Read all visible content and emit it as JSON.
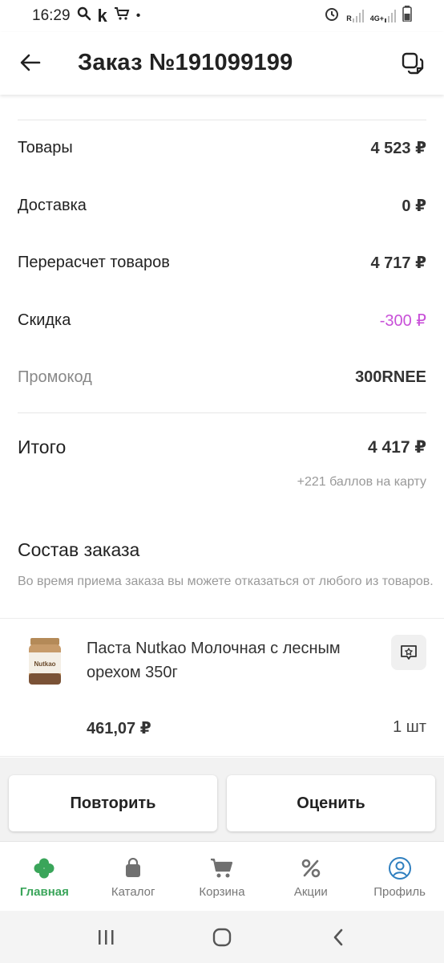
{
  "status_bar": {
    "time": "16:29",
    "k_letter": "k",
    "dot": "•",
    "network": "4G+",
    "roaming": "R"
  },
  "header": {
    "title": "Заказ №191099199"
  },
  "summary": {
    "goods_label": "Товары",
    "goods_value": "4 523 ₽",
    "delivery_label": "Доставка",
    "delivery_value": "0 ₽",
    "recalc_label": "Перерасчет товаров",
    "recalc_value": "4 717 ₽",
    "discount_label": "Скидка",
    "discount_value": "-300 ₽",
    "promo_label": "Промокод",
    "promo_value": "300RNEE",
    "total_label": "Итого",
    "total_value": "4 417 ₽",
    "bonus_text": "+221 баллов на карту"
  },
  "order": {
    "section_title": "Состав заказа",
    "note": "Во время приема заказа вы можете отказаться от любого из товаров.",
    "items": [
      {
        "name": "Паста Nutkao Молочная с лесным орехом 350г",
        "price": "461,07 ₽",
        "quantity": "1 шт",
        "jar_label": "Nutkao"
      }
    ]
  },
  "actions": {
    "repeat_label": "Повторить",
    "rate_label": "Оценить"
  },
  "bottom_nav": {
    "items": [
      {
        "label": "Главная",
        "icon": "clover-icon",
        "active": true
      },
      {
        "label": "Каталог",
        "icon": "bag-icon"
      },
      {
        "label": "Корзина",
        "icon": "cart-icon"
      },
      {
        "label": "Акции",
        "icon": "percent-icon"
      },
      {
        "label": "Профиль",
        "icon": "profile-icon"
      }
    ]
  },
  "colors": {
    "accent_green": "#3aa55a",
    "discount_pink": "#c850d8"
  }
}
